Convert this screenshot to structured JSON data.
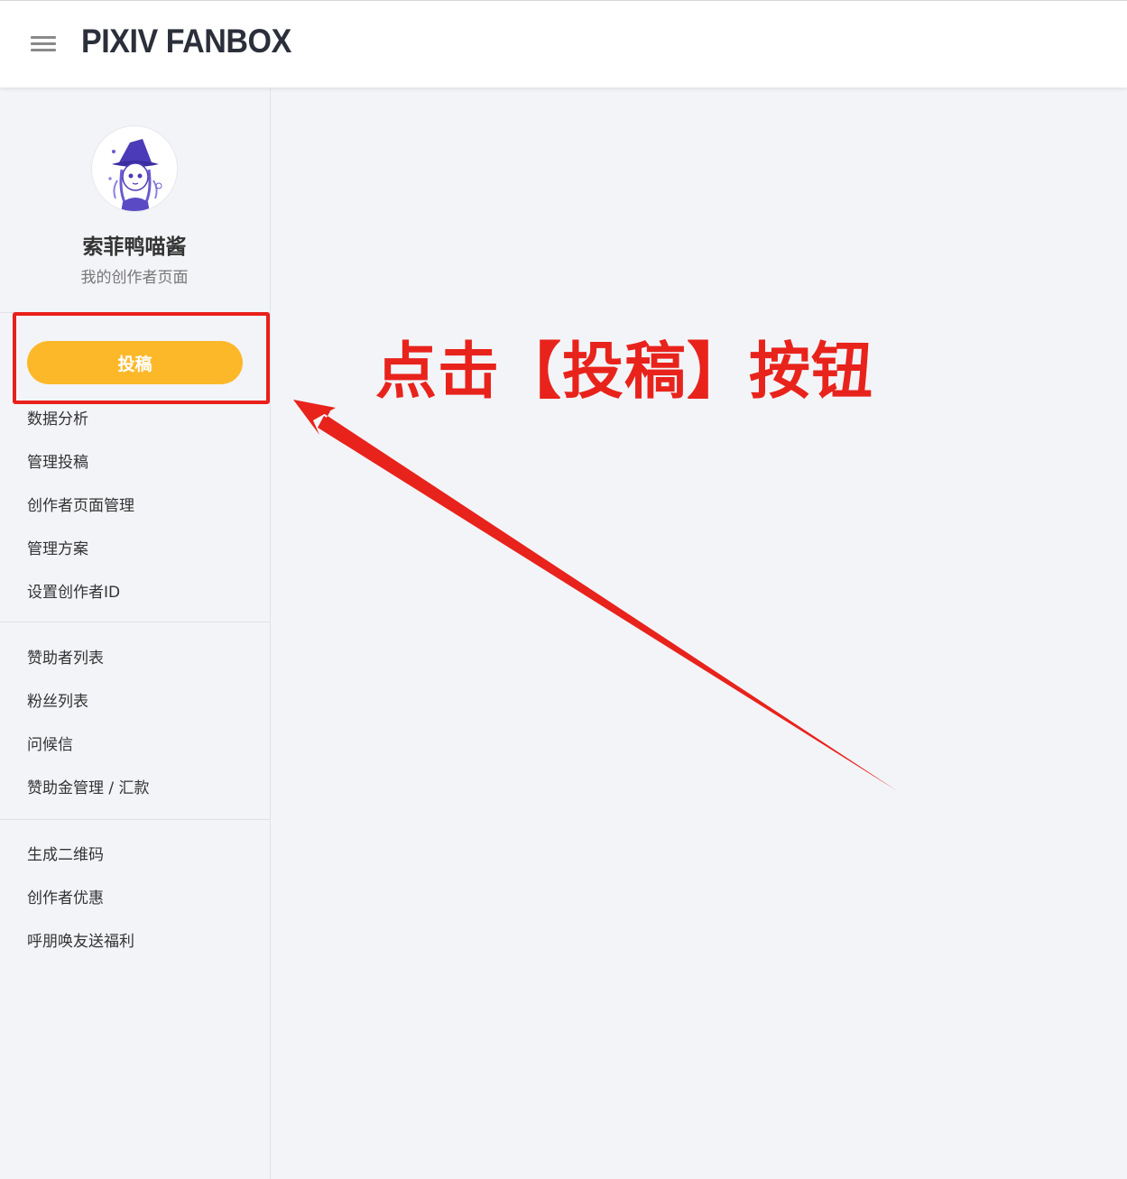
{
  "header": {
    "logo": "PIXIV FANBOX"
  },
  "profile": {
    "name": "索菲鸭喵酱",
    "link_label": "我的创作者页面"
  },
  "post_button_label": "投稿",
  "nav_groups": [
    [
      "数据分析",
      "管理投稿",
      "创作者页面管理",
      "管理方案",
      "设置创作者ID"
    ],
    [
      "赞助者列表",
      "粉丝列表",
      "问候信",
      "赞助金管理 / 汇款"
    ],
    [
      "生成二维码",
      "创作者优惠",
      "呼朋唤友送福利"
    ]
  ],
  "annotation": {
    "text": "点击【投稿】按钮",
    "color": "#e8231c"
  },
  "colors": {
    "accent": "#fdb82a",
    "background": "#f3f4f8"
  }
}
